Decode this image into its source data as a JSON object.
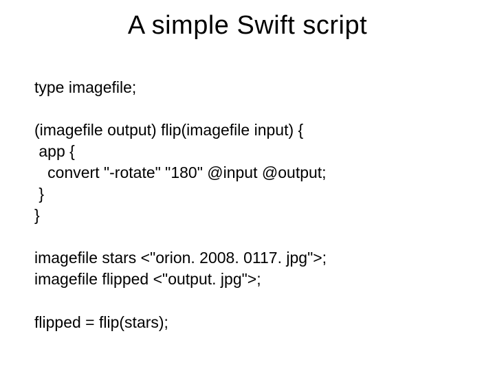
{
  "title": "A simple Swift script",
  "lines": {
    "l0": "type imagefile;",
    "l1": "",
    "l2": "(imagefile output) flip(imagefile input) {",
    "l3": " app {",
    "l4": "   convert \"-rotate\" \"180\" @input @output;",
    "l5": " }",
    "l6": "}",
    "l7": "",
    "l8": "imagefile stars <\"orion. 2008. 0117. jpg\">;",
    "l9": "imagefile flipped <\"output. jpg\">;",
    "l10": "",
    "l11": "flipped = flip(stars);"
  }
}
